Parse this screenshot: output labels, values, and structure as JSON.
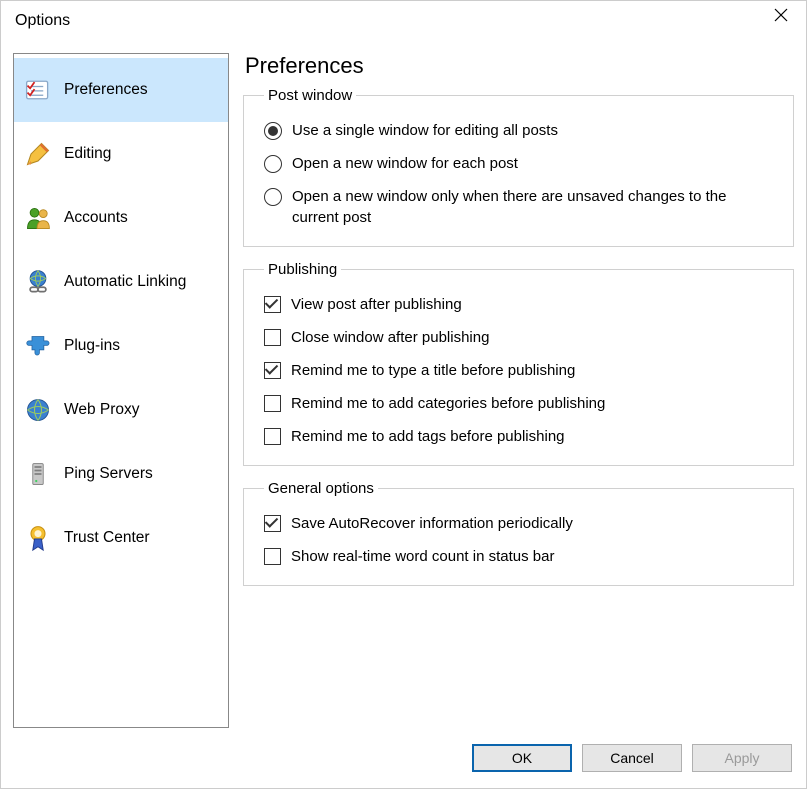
{
  "window": {
    "title": "Options"
  },
  "sidebar": {
    "items": [
      {
        "label": "Preferences"
      },
      {
        "label": "Editing"
      },
      {
        "label": "Accounts"
      },
      {
        "label": "Automatic Linking"
      },
      {
        "label": "Plug-ins"
      },
      {
        "label": "Web Proxy"
      },
      {
        "label": "Ping Servers"
      },
      {
        "label": "Trust Center"
      }
    ]
  },
  "page": {
    "title": "Preferences"
  },
  "postWindow": {
    "legend": "Post window",
    "opt0": "Use a single window for editing all posts",
    "opt1": "Open a new window for each post",
    "opt2": "Open a new window only when there are unsaved changes to the current post",
    "selected": 0
  },
  "publishing": {
    "legend": "Publishing",
    "c0": {
      "label": "View post after publishing",
      "checked": true
    },
    "c1": {
      "label": "Close window after publishing",
      "checked": false
    },
    "c2": {
      "label": "Remind me to type a title before publishing",
      "checked": true
    },
    "c3": {
      "label": "Remind me to add categories before publishing",
      "checked": false
    },
    "c4": {
      "label": "Remind me to add tags before publishing",
      "checked": false
    }
  },
  "general": {
    "legend": "General options",
    "c0": {
      "label": "Save AutoRecover information periodically",
      "checked": true
    },
    "c1": {
      "label": "Show real-time word count in status bar",
      "checked": false
    }
  },
  "buttons": {
    "ok": "OK",
    "cancel": "Cancel",
    "apply": "Apply"
  }
}
